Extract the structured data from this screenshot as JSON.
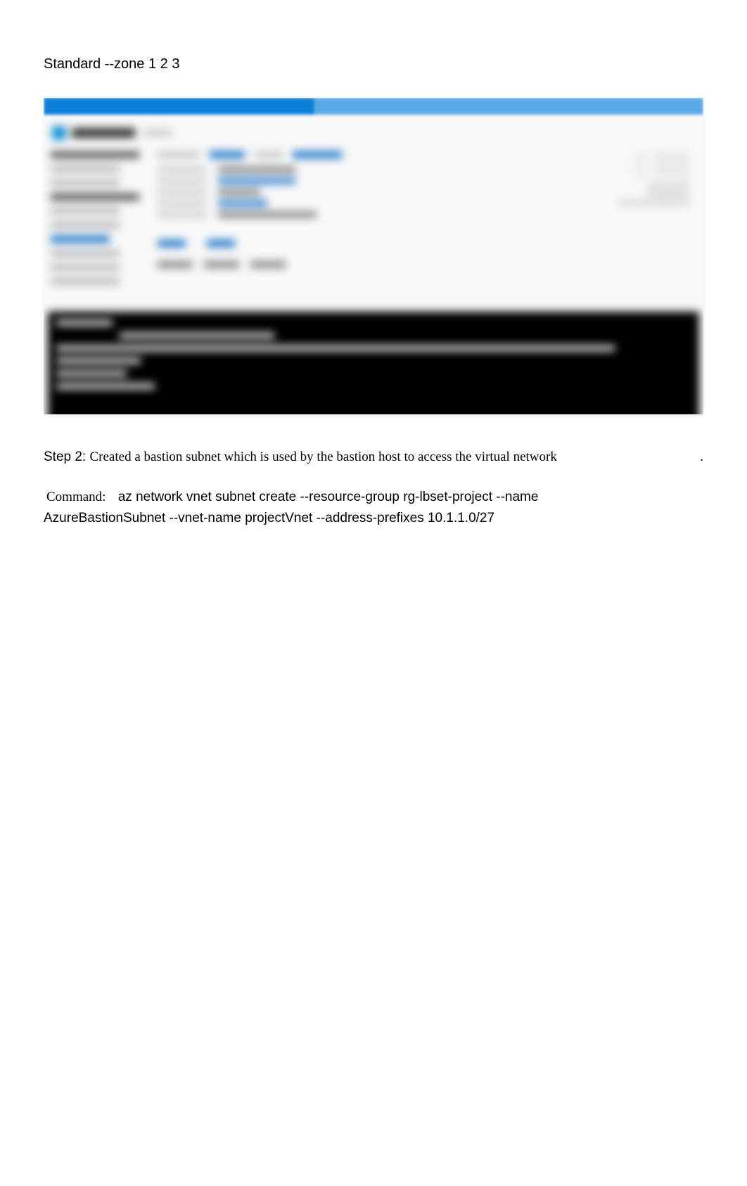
{
  "top": {
    "text": "Standard --zone 1 2 3"
  },
  "step2": {
    "label": "Step 2:",
    "description": "Created a bastion subnet which is used by the bastion host to access the virtual network",
    "trailing_dot": "."
  },
  "command": {
    "label": "Command:",
    "line1": "az network vnet subnet create --resource-group rg-lbset-project --name",
    "line2": "AzureBastionSubnet --vnet-name projectVnet --address-prefixes 10.1.1.0/27"
  }
}
